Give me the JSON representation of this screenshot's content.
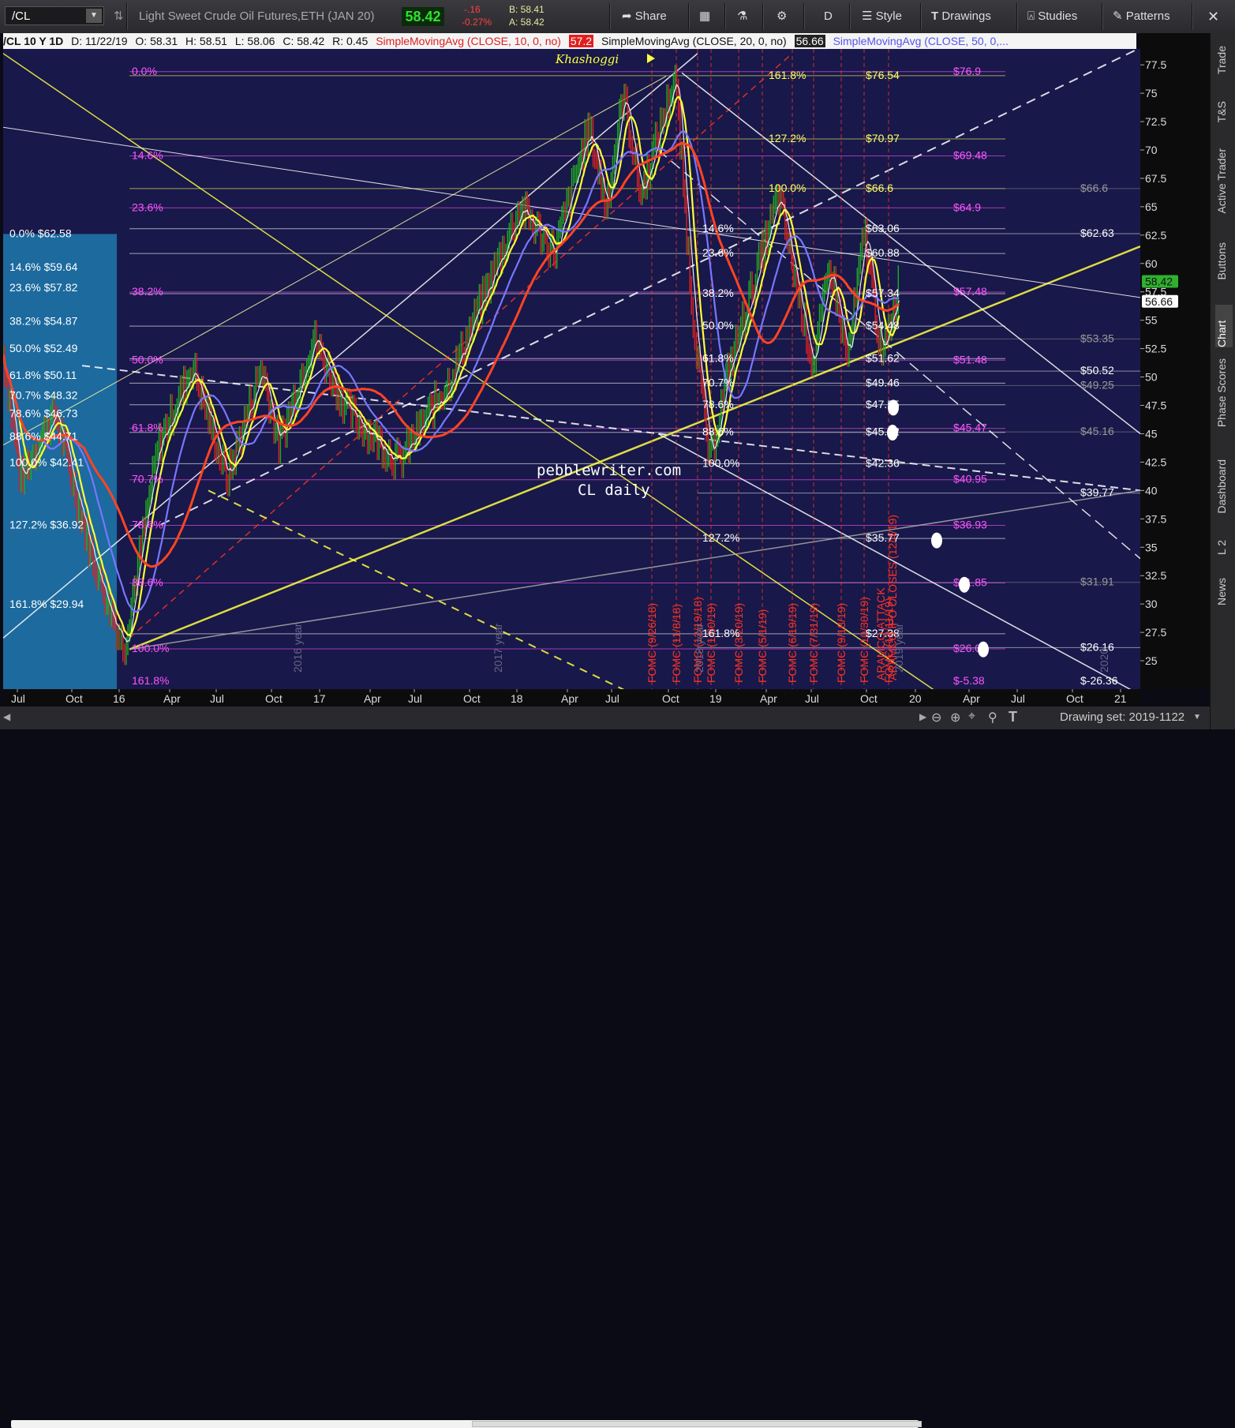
{
  "toolbar": {
    "symbol": "/CL",
    "title": "Light Sweet Crude Oil Futures,ETH (JAN 20)",
    "last": "58.42",
    "change": "-.16",
    "change_pct": "-0.27%",
    "bid": "B: 58.41",
    "ask": "A: 58.42",
    "share": "Share",
    "period": "D",
    "style": "Style",
    "drawings": "Drawings",
    "studies": "Studies",
    "patterns": "Patterns"
  },
  "info": {
    "header": "/CL 10 Y 1D",
    "date": "D: 11/22/19",
    "open": "O: 58.31",
    "high": "H: 58.51",
    "low": "L: 58.06",
    "close": "C: 58.42",
    "range": "R: 0.45",
    "sma10": "SimpleMovingAvg (CLOSE, 10, 0, no)",
    "sma10v": "57.2",
    "sma20": "SimpleMovingAvg (CLOSE, 20, 0, no)",
    "sma20v": "56.66",
    "sma50": "SimpleMovingAvg (CLOSE, 50, 0,..."
  },
  "side": [
    "Trade",
    "T&S",
    "Active Trader",
    "Buttons",
    "Chart",
    "Phase Scores",
    "Dashboard",
    "L 2",
    "News"
  ],
  "status": {
    "drawing_set": "Drawing set: 2019-1122"
  },
  "annotations": {
    "site": "pebblewriter.com",
    "sub": "CL daily",
    "event": "Khashoggi",
    "aramco": "ARAMCO ATTACK",
    "aramco2": "ARAMCO IPO CLOSES (12/4/19)"
  },
  "colors": {
    "bg": "#18184a",
    "up": "#22aa22",
    "down": "#dd2222",
    "sma10": "#ffffff",
    "sma20": "#ffff33",
    "sma50": "#7777ff",
    "sma200": "#ff4422",
    "fib": "#ff55ff"
  },
  "chart_data": {
    "type": "line",
    "title": "/CL 10 Y 1D",
    "x_ticks": [
      "Jul",
      "Oct",
      "16",
      "Apr",
      "Jul",
      "Oct",
      "17",
      "Apr",
      "Jul",
      "Oct",
      "18",
      "Apr",
      "Jul",
      "Oct",
      "19",
      "Apr",
      "Jul",
      "Oct",
      "20",
      "Apr",
      "Jul",
      "Oct",
      "21"
    ],
    "y_ticks": [
      25,
      27.5,
      30,
      32.5,
      35,
      37.5,
      40,
      42.5,
      45,
      47.5,
      50,
      52.5,
      55,
      57.5,
      60,
      62.5,
      65,
      67.5,
      70,
      72.5,
      75,
      77.5
    ],
    "ylim": [
      22.5,
      78.9
    ],
    "price_key_points": [
      {
        "x": "2015-07",
        "y": 52
      },
      {
        "x": "2015-08",
        "y": 41
      },
      {
        "x": "2015-10",
        "y": 47
      },
      {
        "x": "2015-12",
        "y": 35
      },
      {
        "x": "2016-02",
        "y": 26.1
      },
      {
        "x": "2016-04",
        "y": 44
      },
      {
        "x": "2016-06",
        "y": 51
      },
      {
        "x": "2016-08",
        "y": 41
      },
      {
        "x": "2016-10",
        "y": 51
      },
      {
        "x": "2016-11",
        "y": 44
      },
      {
        "x": "2017-01",
        "y": 53.5
      },
      {
        "x": "2017-03",
        "y": 47
      },
      {
        "x": "2017-06",
        "y": 42.5
      },
      {
        "x": "2017-09",
        "y": 50
      },
      {
        "x": "2018-01",
        "y": 65
      },
      {
        "x": "2018-03",
        "y": 61
      },
      {
        "x": "2018-05",
        "y": 72
      },
      {
        "x": "2018-06",
        "y": 65
      },
      {
        "x": "2018-07",
        "y": 75
      },
      {
        "x": "2018-08",
        "y": 66
      },
      {
        "x": "2018-10",
        "y": 76.5
      },
      {
        "x": "2018-11",
        "y": 56
      },
      {
        "x": "2018-12",
        "y": 42.4
      },
      {
        "x": "2019-01",
        "y": 50
      },
      {
        "x": "2019-04",
        "y": 66
      },
      {
        "x": "2019-06",
        "y": 51
      },
      {
        "x": "2019-07",
        "y": 60
      },
      {
        "x": "2019-08",
        "y": 51.5
      },
      {
        "x": "2019-09",
        "y": 63
      },
      {
        "x": "2019-10",
        "y": 51.5
      },
      {
        "x": "2019-11",
        "y": 58.4
      }
    ],
    "series": [
      {
        "name": "SimpleMovingAvg (CLOSE, 10, 0, no)",
        "last": 57.2
      },
      {
        "name": "SimpleMovingAvg (CLOSE, 20, 0, no)",
        "last": 56.66
      },
      {
        "name": "SimpleMovingAvg (CLOSE, 50, 0,..."
      }
    ],
    "levels": [
      {
        "price": 76.54,
        "label": "$76.54",
        "fib": "161.8%",
        "color": "#ffff66"
      },
      {
        "price": 70.97,
        "label": "$70.97",
        "fib": "127.2%",
        "color": "#ffff66"
      },
      {
        "price": 66.6,
        "label": "$66.6",
        "fib": "100.0%",
        "color": "#ffff66"
      },
      {
        "price": 63.06,
        "label": "$63.06",
        "fib": "14.6%",
        "color": "#ffffff"
      },
      {
        "price": 60.88,
        "label": "$60.88",
        "fib": "23.6%",
        "color": "#ffffff"
      },
      {
        "price": 57.34,
        "label": "$57.34",
        "fib": "38.2%",
        "color": "#ffffff"
      },
      {
        "price": 54.48,
        "label": "$54.48",
        "fib": "50.0%",
        "color": "#ffffff"
      },
      {
        "price": 51.62,
        "label": "$51.62",
        "fib": "61.8%",
        "color": "#ffffff"
      },
      {
        "price": 49.46,
        "label": "$49.46",
        "fib": "70.7%",
        "color": "#ffffff"
      },
      {
        "price": 47.55,
        "label": "$47.55",
        "fib": "78.6%",
        "color": "#ffffff"
      },
      {
        "price": 45.12,
        "label": "$45.12",
        "fib": "88.6%",
        "color": "#ffffff"
      },
      {
        "price": 42.36,
        "label": "$42.36",
        "fib": "100.0%",
        "color": "#ffffff"
      },
      {
        "price": 35.77,
        "label": "$35.77",
        "fib": "127.2%",
        "color": "#ffffff"
      },
      {
        "price": 27.38,
        "label": "$27.38",
        "fib": "161.8%",
        "color": "#ffffff"
      },
      {
        "price": 76.9,
        "label": "$76.9",
        "fib": "0.0%",
        "color": "#ff55ff"
      },
      {
        "price": 69.48,
        "label": "$69.48",
        "fib": "14.6%",
        "color": "#ff55ff"
      },
      {
        "price": 64.9,
        "label": "$64.9",
        "fib": "23.6%",
        "color": "#ff55ff"
      },
      {
        "price": 57.48,
        "label": "$57.48",
        "fib": "38.2%",
        "color": "#ff55ff"
      },
      {
        "price": 51.48,
        "label": "$51.48",
        "fib": "50.0%",
        "color": "#ff55ff"
      },
      {
        "price": 45.47,
        "label": "$45.47",
        "fib": "61.8%",
        "color": "#ff55ff"
      },
      {
        "price": 40.95,
        "label": "$40.95",
        "fib": "70.7%",
        "color": "#ff55ff"
      },
      {
        "price": 36.93,
        "label": "$36.93",
        "fib": "78.6%",
        "color": "#ff55ff"
      },
      {
        "price": 31.85,
        "label": "$31.85",
        "fib": "88.6%",
        "color": "#ff55ff"
      },
      {
        "price": 26.05,
        "label": "$26.05",
        "fib": "100.0%",
        "color": "#ff55ff"
      },
      {
        "price": -5.38,
        "label": "$-5.38",
        "fib": "161.8%",
        "color": "#ff55ff"
      }
    ],
    "right_labels": [
      {
        "price": 66.6,
        "label": "$66.6",
        "color": "#999999"
      },
      {
        "price": 62.63,
        "label": "$62.63",
        "color": "#ffffff"
      },
      {
        "price": 53.35,
        "label": "$53.35",
        "color": "#999999"
      },
      {
        "price": 50.52,
        "label": "$50.52",
        "color": "#ffffff"
      },
      {
        "price": 49.25,
        "label": "$49.25",
        "color": "#999999"
      },
      {
        "price": 45.16,
        "label": "$45.16",
        "color": "#999999"
      },
      {
        "price": 39.77,
        "label": "$39.77",
        "color": "#ffffff"
      },
      {
        "price": 31.91,
        "label": "$31.91",
        "color": "#999999"
      },
      {
        "price": 26.16,
        "label": "$26.16",
        "color": "#ffffff"
      },
      {
        "price": -26.36,
        "label": "$-26.36",
        "color": "#ffffff"
      }
    ],
    "left_labels": [
      {
        "price": 62.58,
        "label": "0.0%  $62.58"
      },
      {
        "price": 59.64,
        "label": "14.6%  $59.64"
      },
      {
        "price": 57.82,
        "label": "23.6%  $57.82"
      },
      {
        "price": 54.87,
        "label": "38.2%  $54.87"
      },
      {
        "price": 52.49,
        "label": "50.0%  $52.49"
      },
      {
        "price": 50.11,
        "label": "61.8%  $50.11"
      },
      {
        "price": 48.32,
        "label": "70.7%  $48.32"
      },
      {
        "price": 46.73,
        "label": "78.6%  $46.73"
      },
      {
        "price": 44.71,
        "label": "88.6%  $44.71"
      },
      {
        "price": 42.41,
        "label": "100.0%  $42.41"
      },
      {
        "price": 36.92,
        "label": "127.2%  $36.92"
      },
      {
        "price": 29.94,
        "label": "161.8%  $29.94"
      }
    ],
    "fomc": [
      "FOMC (9/26/18)",
      "FOMC (11/8/18)",
      "FOMC (12/19/18)",
      "FOMC (1/30/19)",
      "FOMC (3/20/19)",
      "FOMC (5/1/19)",
      "FOMC (6/19/19)",
      "FOMC (7/31/19)",
      "FOMC (9/18/19)",
      "FOMC (10/30/19)",
      "FOMC (12/11/19)"
    ],
    "year_marks": [
      "2016 year",
      "2017 year",
      "2018 year",
      "2019 year",
      "2020"
    ]
  }
}
